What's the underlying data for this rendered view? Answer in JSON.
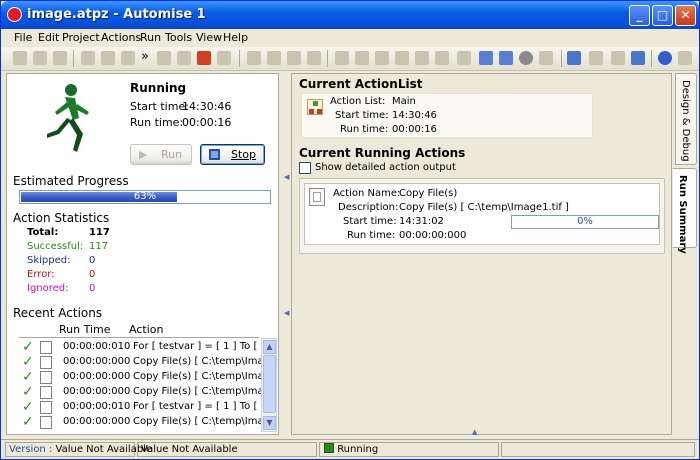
{
  "window": {
    "title": "image.atpz - Automise 1"
  },
  "window_controls": {
    "minimize": "_",
    "maximize": "□",
    "close": "✕"
  },
  "menu": [
    "File",
    "Edit",
    "Project",
    "Actions",
    "Run",
    "Tools",
    "View",
    "Help"
  ],
  "toolbar": {
    "overflow": "»"
  },
  "run_panel": {
    "status": "Running",
    "start_time_label": "Start time:",
    "start_time": "14:30:46",
    "run_time_label": "Run time:",
    "run_time": "00:00:16",
    "run_button": "Run",
    "stop_button": "Stop"
  },
  "estimated_progress": {
    "label": "Estimated Progress",
    "percent_text": "63%",
    "value": 0.63
  },
  "action_statistics": {
    "label": "Action Statistics",
    "rows": [
      {
        "name": "Total:",
        "value": "117",
        "color": "#000000"
      },
      {
        "name": "Successful:",
        "value": "117",
        "color": "#2a8a1a"
      },
      {
        "name": "Skipped:",
        "value": "0",
        "color": "#1a2a9a"
      },
      {
        "name": "Error:",
        "value": "0",
        "color": "#c01010"
      },
      {
        "name": "Ignored:",
        "value": "0",
        "color": "#c010c0"
      }
    ]
  },
  "recent_actions": {
    "label": "Recent Actions",
    "columns": [
      "Run Time",
      "Action"
    ],
    "rows": [
      {
        "time": "00:00:00:010",
        "action": "For [ testvar ] = [ 1 ] To [ ..."
      },
      {
        "time": "00:00:00:000",
        "action": "Copy File(s) [ C:\\temp\\Ima..."
      },
      {
        "time": "00:00:00:000",
        "action": "Copy File(s) [ C:\\temp\\Ima..."
      },
      {
        "time": "00:00:00:000",
        "action": "Copy File(s) [ C:\\temp\\Ima..."
      },
      {
        "time": "00:00:00:010",
        "action": "For [ testvar ] = [ 1 ] To [ ..."
      },
      {
        "time": "00:00:00:000",
        "action": "Copy File(s) [ C:\\temp\\Ima..."
      }
    ]
  },
  "current_actionlist": {
    "header": "Current ActionList",
    "action_list_label": "Action List:",
    "action_list": "Main",
    "start_time_label": "Start time:",
    "start_time": "14:30:46",
    "run_time_label": "Run time:",
    "run_time": "00:00:16"
  },
  "current_running": {
    "header": "Current Running Actions",
    "show_detailed_label": "Show detailed action output",
    "show_detailed_checked": false,
    "action_name_label": "Action Name:",
    "action_name": "Copy File(s)",
    "description_label": "Description:",
    "description": "Copy File(s) [ C:\\temp\\Image1.tif ]",
    "start_time_label": "Start time:",
    "start_time": "14:31:02",
    "progress_text": "0%",
    "run_time_label": "Run time:",
    "run_time": "00:00:00:000"
  },
  "side_tabs": [
    "Design & Debug",
    "Run Summary"
  ],
  "status_bar": {
    "version_label": "Version :",
    "version_value": "Value Not Available",
    "value2": "Value Not Available",
    "state": "Running"
  },
  "colors": {
    "accent": "#0a5fe4",
    "progress": "#3b5bc8",
    "success": "#2a8a1a"
  }
}
